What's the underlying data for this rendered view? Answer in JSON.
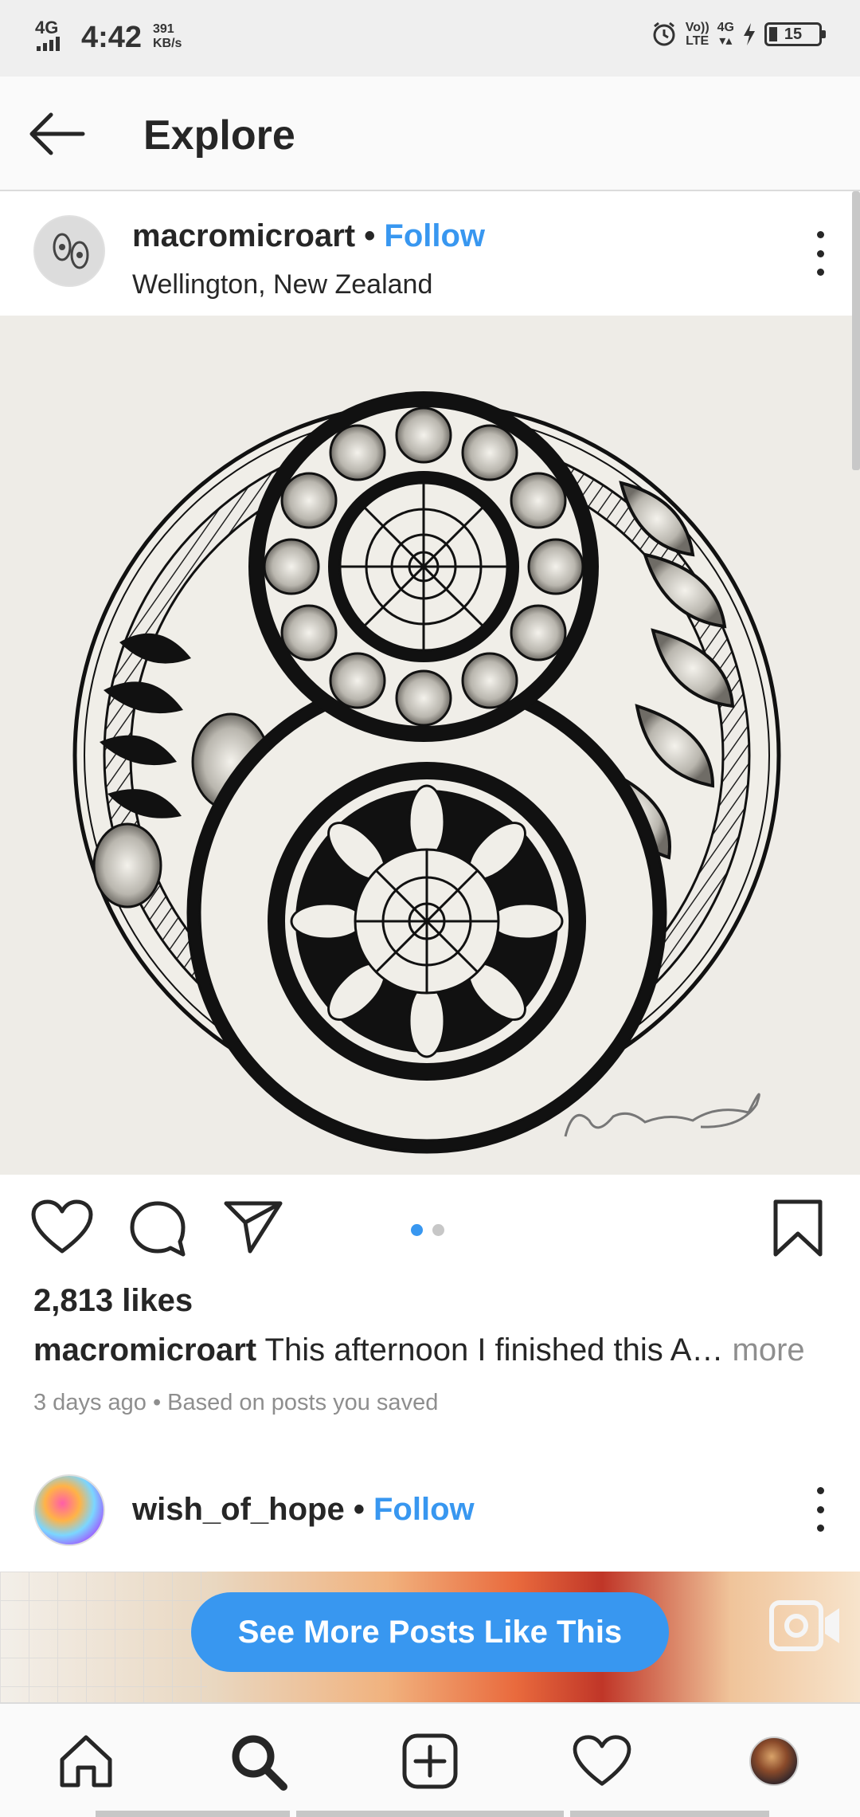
{
  "status_bar": {
    "network": "4G",
    "time": "4:42",
    "speed_value": "391",
    "speed_unit": "KB/s",
    "volte_top": "Vo))",
    "volte_bottom": "LTE",
    "network_right": "4G",
    "battery": "15"
  },
  "header": {
    "title": "Explore"
  },
  "post": {
    "username": "macromicroart",
    "separator": "•",
    "follow_label": "Follow",
    "location": "Wellington, New Zealand",
    "likes": "2,813 likes",
    "caption_user": "macromicroart",
    "caption_text": "This afternoon I finished this A…",
    "caption_more": "more",
    "meta": "3 days ago • Based on posts you saved",
    "carousel_total": 2,
    "carousel_index": 1
  },
  "post2": {
    "username": "wish_of_hope",
    "separator": "•",
    "follow_label": "Follow"
  },
  "banner": {
    "label": "See More Posts Like This"
  },
  "colors": {
    "accent": "#3897f0",
    "text": "#262626",
    "muted": "#8e8e8e"
  },
  "icons": {
    "back": "back-arrow-icon",
    "more": "more-vertical-icon",
    "like": "heart-icon",
    "comment": "comment-icon",
    "share": "paper-plane-icon",
    "save": "bookmark-icon",
    "video": "video-camera-icon",
    "home": "home-icon",
    "search": "search-icon",
    "add": "add-post-icon",
    "activity": "heart-icon",
    "profile": "profile-avatar"
  }
}
